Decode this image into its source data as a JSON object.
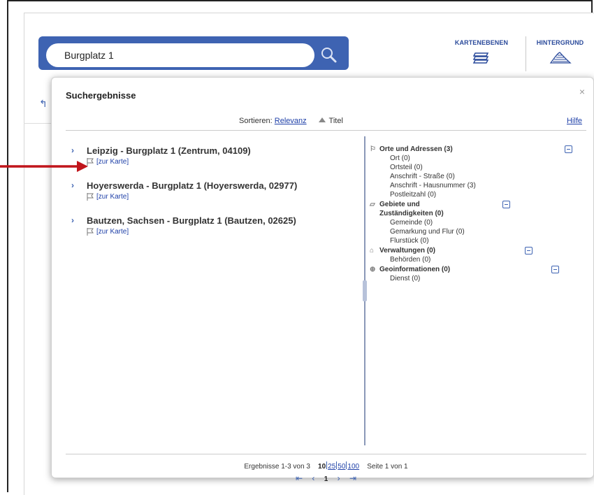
{
  "search": {
    "value": "Burgplatz 1"
  },
  "toolbar": {
    "layers_label": "KARTENEBENEN",
    "background_label": "HINTERGRUND"
  },
  "dialog": {
    "title": "Suchergebnisse",
    "close": "×",
    "sort": {
      "label": "Sortieren:",
      "relevance": "Relevanz",
      "title": "Titel"
    },
    "help": "Hilfe",
    "results": [
      {
        "title": "Leipzig - Burgplatz 1 (Zentrum, 04109)",
        "link": "[zur Karte]"
      },
      {
        "title": "Hoyerswerda - Burgplatz 1 (Hoyerswerda, 02977)",
        "link": "[zur Karte]"
      },
      {
        "title": "Bautzen, Sachsen - Burgplatz 1 (Bautzen, 02625)",
        "link": "[zur Karte]"
      }
    ],
    "categories": [
      {
        "icon": "flag-icon",
        "title": "Orte und Adressen (3)",
        "items": [
          "Ort (0)",
          "Ortsteil (0)",
          "Anschrift - Straße (0)",
          "Anschrift - Hausnummer (3)",
          "Postleitzahl (0)"
        ]
      },
      {
        "icon": "shape-icon",
        "title": "Gebiete und Zuständigkeiten (0)",
        "items": [
          "Gemeinde (0)",
          "Gemarkung und Flur (0)",
          "Flurstück (0)"
        ]
      },
      {
        "icon": "building-icon",
        "title": "Verwaltungen (0)",
        "items": [
          "Behörden (0)"
        ]
      },
      {
        "icon": "globe-icon",
        "title": "Geoinformationen (0)",
        "items": [
          "Dienst (0)"
        ]
      }
    ],
    "footer": {
      "summary": "Ergebnisse 1-3 von 3",
      "page_sizes": [
        "10",
        "25",
        "50",
        "100"
      ],
      "current_page_size": "10",
      "page_info": "Seite 1 von 1",
      "current_page": "1"
    }
  },
  "colors": {
    "accent": "#3e63b2",
    "link": "#1f40a8",
    "arrow": "#c0151b"
  }
}
